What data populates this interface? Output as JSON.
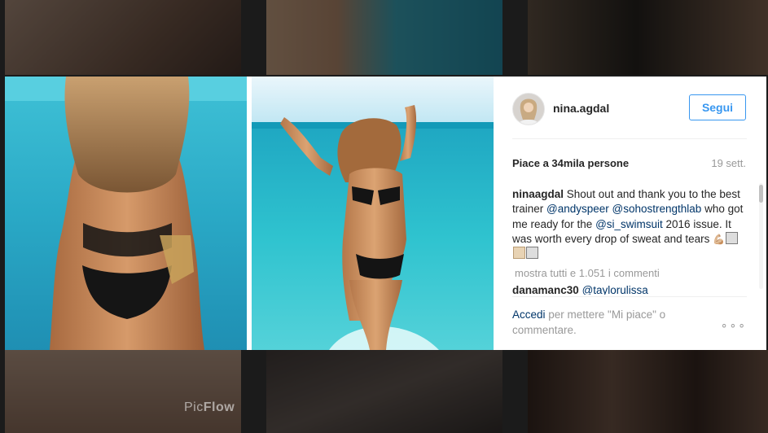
{
  "post": {
    "username": "nina.agdal",
    "follow_label": "Segui",
    "likes": "Piace a 34mila persone",
    "time": "19 sett.",
    "caption": {
      "author": "ninaagdal",
      "text_1": " Shout out and thank you to the best trainer ",
      "mention_1": "@andyspeer",
      "text_2": " ",
      "mention_2": "@sohostrengthlab",
      "text_3": " who got me ready for the ",
      "mention_3": "@si_swimsuit",
      "text_4": " 2016 issue. It was worth every drop of sweat and tears ",
      "emoji": "💪🏼"
    },
    "show_all_comments": "mostra tutti e 1.051 i commenti",
    "next_comment": {
      "author": "danamanc30",
      "mention": "@taylorulissa"
    },
    "footer": {
      "login": "Accedi",
      "rest": " per mettere \"Mi piace\" o commentare."
    },
    "more_label": "∘∘∘"
  },
  "watermark": {
    "prefix": "Pic",
    "suffix": "Flow"
  }
}
